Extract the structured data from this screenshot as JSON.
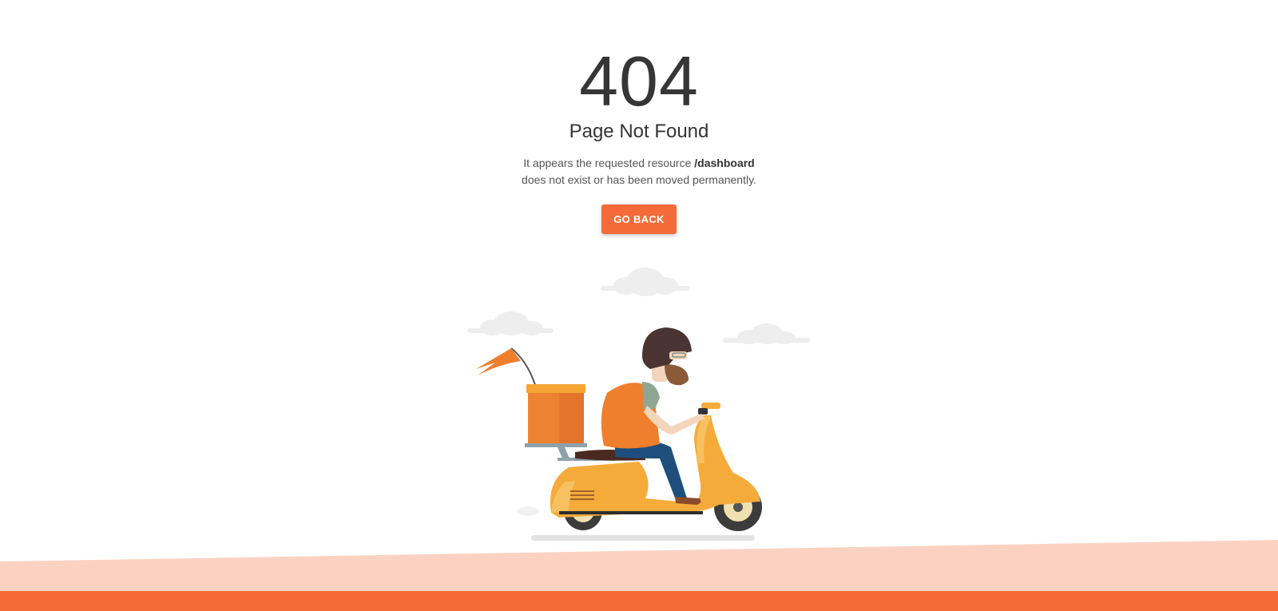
{
  "error": {
    "code": "404",
    "title": "Page Not Found",
    "message_prefix": "It appears the requested resource",
    "resource": "/dashboard",
    "message_suffix": "does not exist or has been moved permanently."
  },
  "actions": {
    "go_back_label": "GO BACK"
  },
  "colors": {
    "accent": "#f46a38",
    "ground_light": "#fbd2c2",
    "scooter": "#f5ab3a",
    "cargo_box": "#ed8330"
  },
  "illustration": {
    "icon": "delivery-scooter-illustration"
  }
}
